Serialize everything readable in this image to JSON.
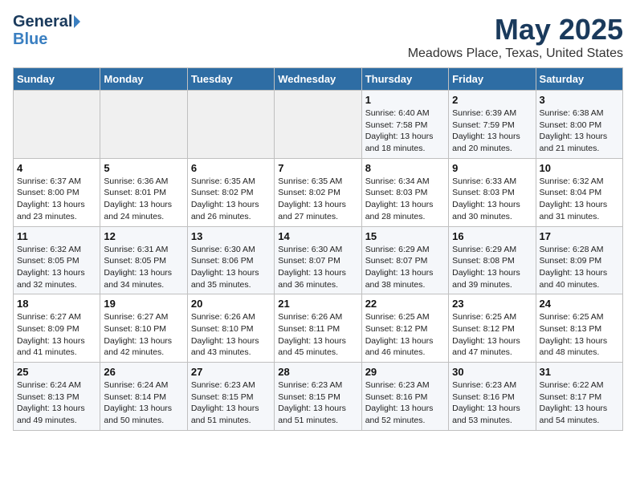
{
  "logo": {
    "text1": "General",
    "text2": "Blue"
  },
  "title": "May 2025",
  "subtitle": "Meadows Place, Texas, United States",
  "days_of_week": [
    "Sunday",
    "Monday",
    "Tuesday",
    "Wednesday",
    "Thursday",
    "Friday",
    "Saturday"
  ],
  "weeks": [
    [
      {
        "day": "",
        "info": ""
      },
      {
        "day": "",
        "info": ""
      },
      {
        "day": "",
        "info": ""
      },
      {
        "day": "",
        "info": ""
      },
      {
        "day": "1",
        "info": "Sunrise: 6:40 AM\nSunset: 7:58 PM\nDaylight: 13 hours\nand 18 minutes."
      },
      {
        "day": "2",
        "info": "Sunrise: 6:39 AM\nSunset: 7:59 PM\nDaylight: 13 hours\nand 20 minutes."
      },
      {
        "day": "3",
        "info": "Sunrise: 6:38 AM\nSunset: 8:00 PM\nDaylight: 13 hours\nand 21 minutes."
      }
    ],
    [
      {
        "day": "4",
        "info": "Sunrise: 6:37 AM\nSunset: 8:00 PM\nDaylight: 13 hours\nand 23 minutes."
      },
      {
        "day": "5",
        "info": "Sunrise: 6:36 AM\nSunset: 8:01 PM\nDaylight: 13 hours\nand 24 minutes."
      },
      {
        "day": "6",
        "info": "Sunrise: 6:35 AM\nSunset: 8:02 PM\nDaylight: 13 hours\nand 26 minutes."
      },
      {
        "day": "7",
        "info": "Sunrise: 6:35 AM\nSunset: 8:02 PM\nDaylight: 13 hours\nand 27 minutes."
      },
      {
        "day": "8",
        "info": "Sunrise: 6:34 AM\nSunset: 8:03 PM\nDaylight: 13 hours\nand 28 minutes."
      },
      {
        "day": "9",
        "info": "Sunrise: 6:33 AM\nSunset: 8:03 PM\nDaylight: 13 hours\nand 30 minutes."
      },
      {
        "day": "10",
        "info": "Sunrise: 6:32 AM\nSunset: 8:04 PM\nDaylight: 13 hours\nand 31 minutes."
      }
    ],
    [
      {
        "day": "11",
        "info": "Sunrise: 6:32 AM\nSunset: 8:05 PM\nDaylight: 13 hours\nand 32 minutes."
      },
      {
        "day": "12",
        "info": "Sunrise: 6:31 AM\nSunset: 8:05 PM\nDaylight: 13 hours\nand 34 minutes."
      },
      {
        "day": "13",
        "info": "Sunrise: 6:30 AM\nSunset: 8:06 PM\nDaylight: 13 hours\nand 35 minutes."
      },
      {
        "day": "14",
        "info": "Sunrise: 6:30 AM\nSunset: 8:07 PM\nDaylight: 13 hours\nand 36 minutes."
      },
      {
        "day": "15",
        "info": "Sunrise: 6:29 AM\nSunset: 8:07 PM\nDaylight: 13 hours\nand 38 minutes."
      },
      {
        "day": "16",
        "info": "Sunrise: 6:29 AM\nSunset: 8:08 PM\nDaylight: 13 hours\nand 39 minutes."
      },
      {
        "day": "17",
        "info": "Sunrise: 6:28 AM\nSunset: 8:09 PM\nDaylight: 13 hours\nand 40 minutes."
      }
    ],
    [
      {
        "day": "18",
        "info": "Sunrise: 6:27 AM\nSunset: 8:09 PM\nDaylight: 13 hours\nand 41 minutes."
      },
      {
        "day": "19",
        "info": "Sunrise: 6:27 AM\nSunset: 8:10 PM\nDaylight: 13 hours\nand 42 minutes."
      },
      {
        "day": "20",
        "info": "Sunrise: 6:26 AM\nSunset: 8:10 PM\nDaylight: 13 hours\nand 43 minutes."
      },
      {
        "day": "21",
        "info": "Sunrise: 6:26 AM\nSunset: 8:11 PM\nDaylight: 13 hours\nand 45 minutes."
      },
      {
        "day": "22",
        "info": "Sunrise: 6:25 AM\nSunset: 8:12 PM\nDaylight: 13 hours\nand 46 minutes."
      },
      {
        "day": "23",
        "info": "Sunrise: 6:25 AM\nSunset: 8:12 PM\nDaylight: 13 hours\nand 47 minutes."
      },
      {
        "day": "24",
        "info": "Sunrise: 6:25 AM\nSunset: 8:13 PM\nDaylight: 13 hours\nand 48 minutes."
      }
    ],
    [
      {
        "day": "25",
        "info": "Sunrise: 6:24 AM\nSunset: 8:13 PM\nDaylight: 13 hours\nand 49 minutes."
      },
      {
        "day": "26",
        "info": "Sunrise: 6:24 AM\nSunset: 8:14 PM\nDaylight: 13 hours\nand 50 minutes."
      },
      {
        "day": "27",
        "info": "Sunrise: 6:23 AM\nSunset: 8:15 PM\nDaylight: 13 hours\nand 51 minutes."
      },
      {
        "day": "28",
        "info": "Sunrise: 6:23 AM\nSunset: 8:15 PM\nDaylight: 13 hours\nand 51 minutes."
      },
      {
        "day": "29",
        "info": "Sunrise: 6:23 AM\nSunset: 8:16 PM\nDaylight: 13 hours\nand 52 minutes."
      },
      {
        "day": "30",
        "info": "Sunrise: 6:23 AM\nSunset: 8:16 PM\nDaylight: 13 hours\nand 53 minutes."
      },
      {
        "day": "31",
        "info": "Sunrise: 6:22 AM\nSunset: 8:17 PM\nDaylight: 13 hours\nand 54 minutes."
      }
    ]
  ]
}
